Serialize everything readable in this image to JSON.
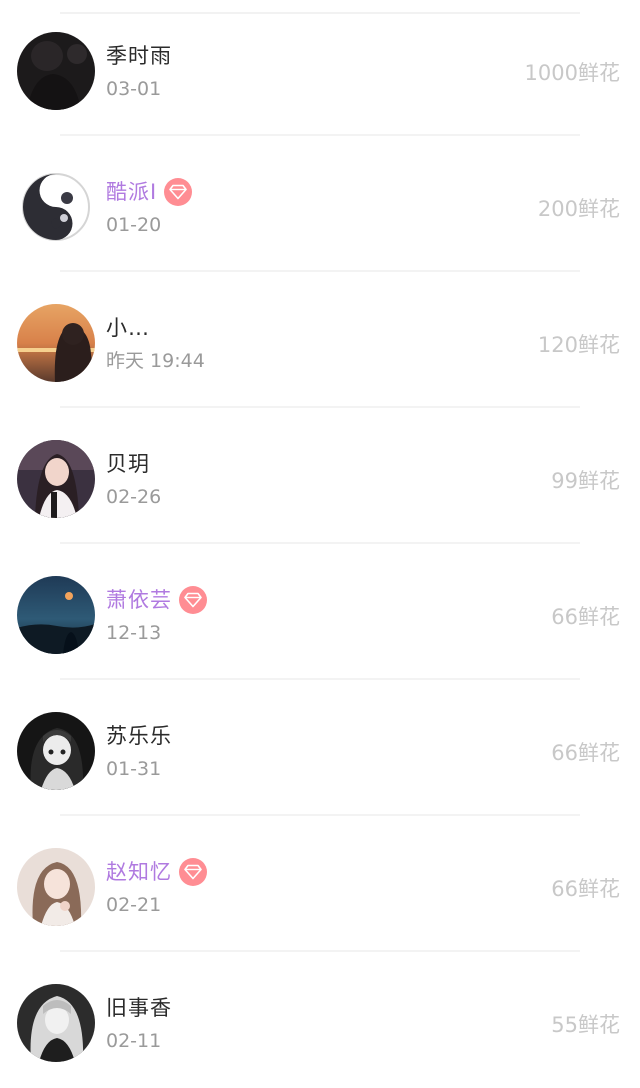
{
  "gift_records": [
    {
      "name": "季时雨",
      "date": "03-01",
      "gift": "1000鲜花",
      "vip": false,
      "avatar": "avatar-dark-silhouette"
    },
    {
      "name": "酷派I",
      "date": "01-20",
      "gift": "200鲜花",
      "vip": true,
      "avatar": "avatar-yin-yang"
    },
    {
      "name": "小…",
      "date": "昨天 19:44",
      "gift": "120鲜花",
      "vip": false,
      "avatar": "avatar-sunset-girl"
    },
    {
      "name": "贝玥",
      "date": "02-26",
      "gift": "99鲜花",
      "vip": false,
      "avatar": "avatar-girl-portrait"
    },
    {
      "name": "萧依芸",
      "date": "12-13",
      "gift": "66鲜花",
      "vip": true,
      "avatar": "avatar-night-sea"
    },
    {
      "name": "苏乐乐",
      "date": "01-31",
      "gift": "66鲜花",
      "vip": false,
      "avatar": "avatar-anime-bw"
    },
    {
      "name": "赵知忆",
      "date": "02-21",
      "gift": "66鲜花",
      "vip": true,
      "avatar": "avatar-girl-light"
    },
    {
      "name": "旧事香",
      "date": "02-11",
      "gift": "55鲜花",
      "vip": false,
      "avatar": "avatar-girl-bw"
    }
  ],
  "colors": {
    "vip_name": "#b07ae0",
    "badge": "#ff8d93",
    "name": "#2b2b2b",
    "date": "#9a9a9a",
    "gift": "#c8c8c8"
  },
  "icons": {
    "vip_badge": "diamond-icon"
  }
}
